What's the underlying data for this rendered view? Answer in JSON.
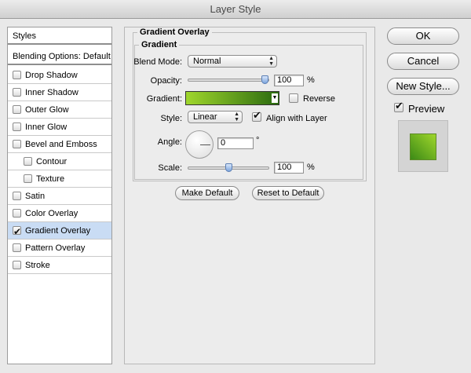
{
  "window": {
    "title": "Layer Style"
  },
  "sidebar": {
    "items": [
      {
        "label": "Styles",
        "checkbox": false,
        "checked": false,
        "selected": false
      },
      {
        "label": "Blending Options: Default",
        "checkbox": false,
        "checked": false,
        "selected": false
      },
      {
        "label": "Drop Shadow",
        "checkbox": true,
        "checked": false,
        "selected": false
      },
      {
        "label": "Inner Shadow",
        "checkbox": true,
        "checked": false,
        "selected": false
      },
      {
        "label": "Outer Glow",
        "checkbox": true,
        "checked": false,
        "selected": false
      },
      {
        "label": "Inner Glow",
        "checkbox": true,
        "checked": false,
        "selected": false
      },
      {
        "label": "Bevel and Emboss",
        "checkbox": true,
        "checked": false,
        "selected": false
      },
      {
        "label": "Contour",
        "checkbox": true,
        "checked": false,
        "selected": false,
        "indent": true
      },
      {
        "label": "Texture",
        "checkbox": true,
        "checked": false,
        "selected": false,
        "indent": true
      },
      {
        "label": "Satin",
        "checkbox": true,
        "checked": false,
        "selected": false
      },
      {
        "label": "Color Overlay",
        "checkbox": true,
        "checked": false,
        "selected": false
      },
      {
        "label": "Gradient Overlay",
        "checkbox": true,
        "checked": true,
        "selected": true
      },
      {
        "label": "Pattern Overlay",
        "checkbox": true,
        "checked": false,
        "selected": false
      },
      {
        "label": "Stroke",
        "checkbox": true,
        "checked": false,
        "selected": false
      }
    ]
  },
  "panel": {
    "title": "Gradient Overlay",
    "group_title": "Gradient",
    "blend_mode_label": "Blend Mode:",
    "blend_mode_value": "Normal",
    "opacity_label": "Opacity:",
    "opacity_value": "100",
    "opacity_level": 1.0,
    "opacity_unit": "%",
    "gradient_label": "Gradient:",
    "gradient_colors": [
      "#9fd62c",
      "#2b6a10"
    ],
    "reverse_label": "Reverse",
    "reverse_checked": false,
    "style_label": "Style:",
    "style_value": "Linear",
    "align_label": "Align with Layer",
    "align_checked": true,
    "angle_label": "Angle:",
    "angle_value": "0",
    "angle_unit": "°",
    "scale_label": "Scale:",
    "scale_value": "100",
    "scale_level": 0.5,
    "scale_unit": "%",
    "make_default_label": "Make Default",
    "reset_default_label": "Reset to Default"
  },
  "actions": {
    "ok_label": "OK",
    "cancel_label": "Cancel",
    "new_style_label": "New Style...",
    "preview_label": "Preview",
    "preview_checked": true
  },
  "colors": {
    "selected_row": "#c9dcf4",
    "preview_gradient": [
      "#9fd62c",
      "#3c8a16"
    ]
  }
}
